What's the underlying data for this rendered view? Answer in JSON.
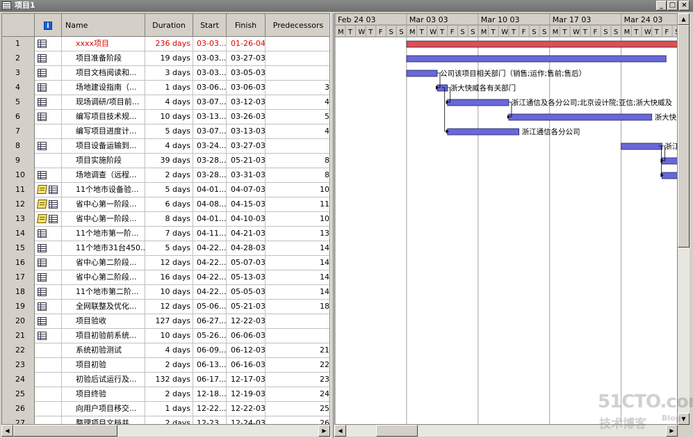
{
  "window": {
    "title": "项目1",
    "minimize": "_",
    "restore": "□",
    "close": "×"
  },
  "columns": {
    "info": "i",
    "name": "Name",
    "duration": "Duration",
    "start": "Start",
    "finish": "Finish",
    "predecessors": "Predecessors"
  },
  "rows": [
    {
      "id": "1",
      "icons": [
        "table-icon"
      ],
      "name": "xxxx项目",
      "duration": "236 days",
      "start": "03-03...",
      "finish": "01-26-04",
      "pred": "",
      "highlight": true
    },
    {
      "id": "2",
      "icons": [
        "table-icon"
      ],
      "name": "项目准备阶段",
      "duration": "19 days",
      "start": "03-03...",
      "finish": "03-27-03",
      "pred": ""
    },
    {
      "id": "3",
      "icons": [
        "table-icon"
      ],
      "name": "项目文档阅读和...",
      "duration": "3 days",
      "start": "03-03...",
      "finish": "03-05-03",
      "pred": ""
    },
    {
      "id": "4",
      "icons": [
        "table-icon"
      ],
      "name": "场地建设指南（...",
      "duration": "1 days",
      "start": "03-06...",
      "finish": "03-06-03",
      "pred": "3"
    },
    {
      "id": "5",
      "icons": [
        "table-icon"
      ],
      "name": "现场调研/项目前...",
      "duration": "4 days",
      "start": "03-07...",
      "finish": "03-12-03",
      "pred": "4"
    },
    {
      "id": "6",
      "icons": [
        "table-icon"
      ],
      "name": "编写项目技术规...",
      "duration": "10 days",
      "start": "03-13...",
      "finish": "03-26-03",
      "pred": "5"
    },
    {
      "id": "7",
      "icons": [],
      "name": "编写项目进度计...",
      "duration": "5 days",
      "start": "03-07...",
      "finish": "03-13-03",
      "pred": "4"
    },
    {
      "id": "8",
      "icons": [
        "table-icon"
      ],
      "name": "项目设备运输到...",
      "duration": "4 days",
      "start": "03-24...",
      "finish": "03-27-03",
      "pred": ""
    },
    {
      "id": "9",
      "icons": [],
      "name": "项目实施阶段",
      "duration": "39 days",
      "start": "03-28...",
      "finish": "05-21-03",
      "pred": "8"
    },
    {
      "id": "10",
      "icons": [
        "table-icon"
      ],
      "name": "场地调查（远程...",
      "duration": "2 days",
      "start": "03-28...",
      "finish": "03-31-03",
      "pred": "8"
    },
    {
      "id": "11",
      "icons": [
        "note-icon",
        "table-icon"
      ],
      "name": "11个地市设备验...",
      "duration": "5 days",
      "start": "04-01...",
      "finish": "04-07-03",
      "pred": "10"
    },
    {
      "id": "12",
      "icons": [
        "note-icon",
        "table-icon"
      ],
      "name": "省中心第一阶段...",
      "duration": "6 days",
      "start": "04-08...",
      "finish": "04-15-03",
      "pred": "11"
    },
    {
      "id": "13",
      "icons": [
        "note-icon",
        "table-icon"
      ],
      "name": "省中心第一阶段...",
      "duration": "8 days",
      "start": "04-01...",
      "finish": "04-10-03",
      "pred": "10"
    },
    {
      "id": "14",
      "icons": [
        "table-icon"
      ],
      "name": "11个地市第一阶...",
      "duration": "7 days",
      "start": "04-11...",
      "finish": "04-21-03",
      "pred": "13"
    },
    {
      "id": "15",
      "icons": [
        "table-icon"
      ],
      "name": "11个地市31台450...",
      "duration": "5 days",
      "start": "04-22...",
      "finish": "04-28-03",
      "pred": "14"
    },
    {
      "id": "16",
      "icons": [
        "table-icon"
      ],
      "name": "省中心第二阶段...",
      "duration": "12 days",
      "start": "04-22...",
      "finish": "05-07-03",
      "pred": "14"
    },
    {
      "id": "17",
      "icons": [
        "table-icon"
      ],
      "name": "省中心第二阶段...",
      "duration": "16 days",
      "start": "04-22...",
      "finish": "05-13-03",
      "pred": "14"
    },
    {
      "id": "18",
      "icons": [
        "table-icon"
      ],
      "name": "11个地市第二阶...",
      "duration": "10 days",
      "start": "04-22...",
      "finish": "05-05-03",
      "pred": "14"
    },
    {
      "id": "19",
      "icons": [
        "table-icon"
      ],
      "name": "全网联整及优化...",
      "duration": "12 days",
      "start": "05-06...",
      "finish": "05-21-03",
      "pred": "18"
    },
    {
      "id": "20",
      "icons": [
        "table-icon"
      ],
      "name": "项目验收",
      "duration": "127 days",
      "start": "06-27...",
      "finish": "12-22-03",
      "pred": ""
    },
    {
      "id": "21",
      "icons": [
        "table-icon"
      ],
      "name": "项目初验前系统...",
      "duration": "10 days",
      "start": "05-26...",
      "finish": "06-06-03",
      "pred": ""
    },
    {
      "id": "22",
      "icons": [],
      "name": "系统初验测试",
      "duration": "4 days",
      "start": "06-09...",
      "finish": "06-12-03",
      "pred": "21"
    },
    {
      "id": "23",
      "icons": [],
      "name": "项目初验",
      "duration": "2 days",
      "start": "06-13...",
      "finish": "06-16-03",
      "pred": "22"
    },
    {
      "id": "24",
      "icons": [],
      "name": "初验后试运行及...",
      "duration": "132 days",
      "start": "06-17...",
      "finish": "12-17-03",
      "pred": "23"
    },
    {
      "id": "25",
      "icons": [],
      "name": "项目终验",
      "duration": "2 days",
      "start": "12-18...",
      "finish": "12-19-03",
      "pred": "24"
    },
    {
      "id": "26",
      "icons": [],
      "name": "向用户项目移交...",
      "duration": "1 days",
      "start": "12-22...",
      "finish": "12-22-03",
      "pred": "25"
    },
    {
      "id": "27",
      "icons": [],
      "name": "整理项目文档并...",
      "duration": "2 days",
      "start": "12-23...",
      "finish": "12-24-03",
      "pred": "26"
    }
  ],
  "gantt": {
    "weeks": [
      "Feb 24 03",
      "Mar 03 03",
      "Mar 10 03",
      "Mar 17 03",
      "Mar 24 03"
    ],
    "weekdays": [
      "M",
      "T",
      "W",
      "T",
      "F",
      "S",
      "S"
    ],
    "bar_labels": {
      "r3": "公司该项目相关部门（销售;运作;售前;售后）",
      "r4": "浙大快威各有关部门",
      "r5": "浙江通信及各分公司;北京设计院;亚信;浙大快威及",
      "r6": "浙大快",
      "r7": "浙江通信各分公司",
      "r8": "浙江"
    },
    "colors": {
      "summary": "#dc5050",
      "task": "#6868d8"
    }
  },
  "watermark": {
    "line1": "51CTO.com",
    "line2": "技术博客",
    "line3": "Blog"
  }
}
